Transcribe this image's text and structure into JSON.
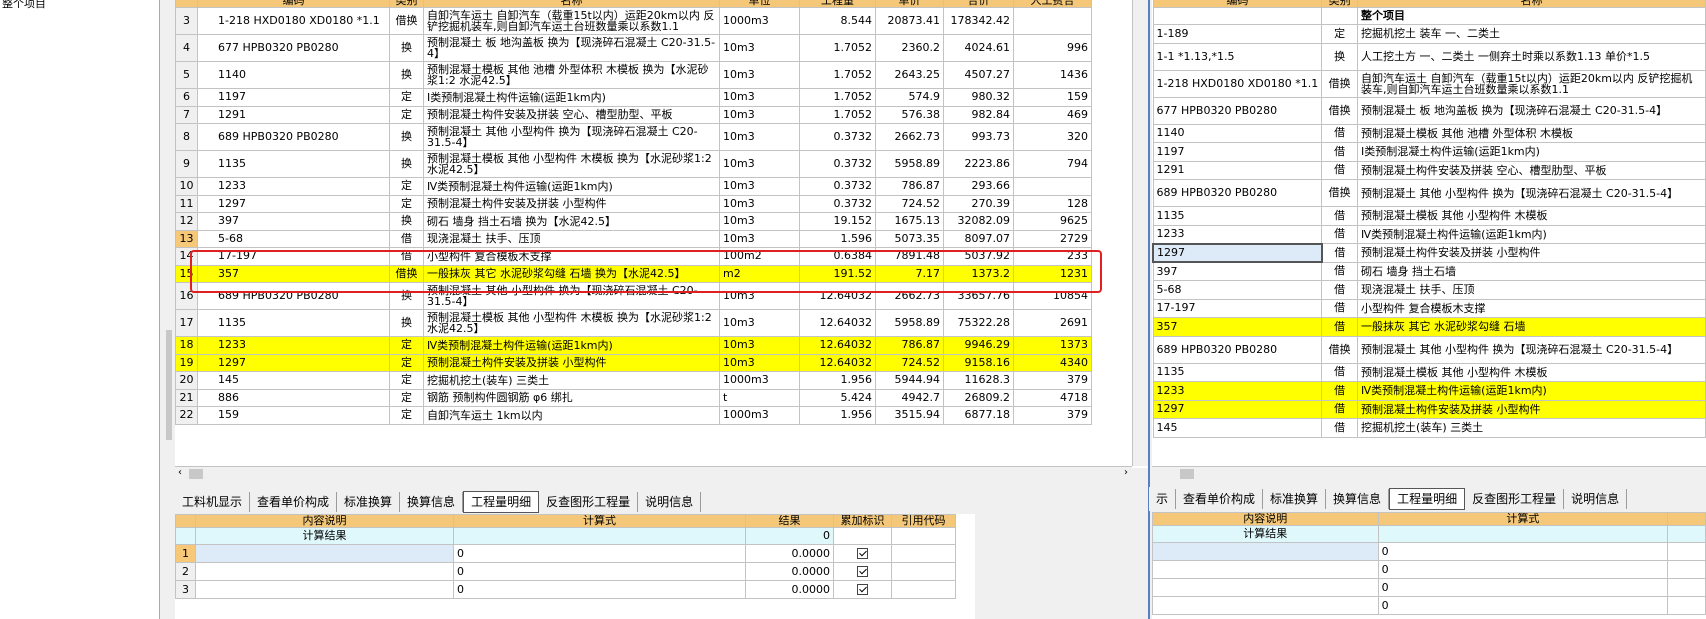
{
  "left_tree": {
    "root_label": "整个项目"
  },
  "main_grid": {
    "columns": [
      "编码",
      "类别",
      "名称",
      "单位",
      "工程量",
      "单价",
      "合价",
      "人工费合"
    ],
    "rows": [
      {
        "num": "3",
        "code": "1-218 HXD0180 XD0180 *1.1",
        "type": "借换",
        "name": "自卸汽车运土 自卸汽车（载重15t以内）运距20km以内 反铲挖掘机装车,则自卸汽车运土台班数量乘以系数1.1",
        "unit": "1000m3",
        "qty": "8.544",
        "price": "20873.41",
        "total": "178342.42",
        "labor": ""
      },
      {
        "num": "4",
        "code": "677 HPB0320 PB0280",
        "type": "换",
        "name": "预制混凝土 板 地沟盖板  换为【现浇碎石混凝土 C20-31.5-4】",
        "unit": "10m3",
        "qty": "1.7052",
        "price": "2360.2",
        "total": "4024.61",
        "labor": "996"
      },
      {
        "num": "5",
        "code": "1140",
        "type": "换",
        "name": "预制混凝土模板 其他 池槽 外型体积 木模板  换为【水泥砂浆1:2 水泥42.5】",
        "unit": "10m3",
        "qty": "1.7052",
        "price": "2643.25",
        "total": "4507.27",
        "labor": "1436"
      },
      {
        "num": "6",
        "code": "1197",
        "type": "定",
        "name": "Ⅰ类预制混凝土构件运输(运距1km内)",
        "unit": "10m3",
        "qty": "1.7052",
        "price": "574.9",
        "total": "980.32",
        "labor": "159"
      },
      {
        "num": "7",
        "code": "1291",
        "type": "定",
        "name": "预制混凝土构件安装及拼装 空心、槽型肋型、平板",
        "unit": "10m3",
        "qty": "1.7052",
        "price": "576.38",
        "total": "982.84",
        "labor": "469"
      },
      {
        "num": "8",
        "code": "689 HPB0320 PB0280",
        "type": "换",
        "name": "预制混凝土 其他 小型构件  换为【现浇碎石混凝土 C20-31.5-4】",
        "unit": "10m3",
        "qty": "0.3732",
        "price": "2662.73",
        "total": "993.73",
        "labor": "320"
      },
      {
        "num": "9",
        "code": "1135",
        "type": "换",
        "name": "预制混凝土模板 其他 小型构件 木模板  换为【水泥砂浆1:2 水泥42.5】",
        "unit": "10m3",
        "qty": "0.3732",
        "price": "5958.89",
        "total": "2223.86",
        "labor": "794"
      },
      {
        "num": "10",
        "code": "1233",
        "type": "定",
        "name": "Ⅳ类预制混凝土构件运输(运距1km内)",
        "unit": "10m3",
        "qty": "0.3732",
        "price": "786.87",
        "total": "293.66",
        "labor": ""
      },
      {
        "num": "11",
        "code": "1297",
        "type": "定",
        "name": "预制混凝土构件安装及拼装 小型构件",
        "unit": "10m3",
        "qty": "0.3732",
        "price": "724.52",
        "total": "270.39",
        "labor": "128"
      },
      {
        "num": "12",
        "code": "397",
        "type": "换",
        "name": "砌石 墙身 挡土石墙  换为【水泥42.5】",
        "unit": "10m3",
        "qty": "19.152",
        "price": "1675.13",
        "total": "32082.09",
        "labor": "9625"
      },
      {
        "num": "13",
        "code": "5-68",
        "type": "借",
        "name": "现浇混凝土 扶手、压顶",
        "unit": "10m3",
        "qty": "1.596",
        "price": "5073.35",
        "total": "8097.07",
        "labor": "2729"
      },
      {
        "num": "14",
        "code": "17-197",
        "type": "借",
        "name": "小型构件 复合模板木支撑",
        "unit": "100m2",
        "qty": "0.6384",
        "price": "7891.48",
        "total": "5037.92",
        "labor": "233"
      },
      {
        "num": "15",
        "code": "357",
        "type": "借换",
        "name": "一般抹灰 其它 水泥砂浆勾缝 石墙  换为【水泥42.5】",
        "unit": "m2",
        "qty": "191.52",
        "price": "7.17",
        "total": "1373.2",
        "labor": "1231"
      },
      {
        "num": "16",
        "code": "689 HPB0320 PB0280",
        "type": "换",
        "name": "预制混凝土 其他 小型构件  换为【现浇碎石混凝土 C20-31.5-4】",
        "unit": "10m3",
        "qty": "12.64032",
        "price": "2662.73",
        "total": "33657.76",
        "labor": "10854"
      },
      {
        "num": "17",
        "code": "1135",
        "type": "换",
        "name": "预制混凝土模板 其他 小型构件 木模板  换为【水泥砂浆1:2 水泥42.5】",
        "unit": "10m3",
        "qty": "12.64032",
        "price": "5958.89",
        "total": "75322.28",
        "labor": "2691"
      },
      {
        "num": "18",
        "code": "1233",
        "type": "定",
        "name": "Ⅳ类预制混凝土构件运输(运距1km内)",
        "unit": "10m3",
        "qty": "12.64032",
        "price": "786.87",
        "total": "9946.29",
        "labor": "1373"
      },
      {
        "num": "19",
        "code": "1297",
        "type": "定",
        "name": "预制混凝土构件安装及拼装 小型构件",
        "unit": "10m3",
        "qty": "12.64032",
        "price": "724.52",
        "total": "9158.16",
        "labor": "4340"
      },
      {
        "num": "20",
        "code": "145",
        "type": "定",
        "name": "挖掘机挖土(装车) 三类土",
        "unit": "1000m3",
        "qty": "1.956",
        "price": "5944.94",
        "total": "11628.3",
        "labor": "379"
      },
      {
        "num": "21",
        "code": "886",
        "type": "定",
        "name": "钢筋 预制构件圆钢筋 φ6 绑扎",
        "unit": "t",
        "qty": "5.424",
        "price": "4942.7",
        "total": "26809.2",
        "labor": "4718"
      },
      {
        "num": "22",
        "code": "159",
        "type": "定",
        "name": "自卸汽车运土 1km以内",
        "unit": "1000m3",
        "qty": "1.956",
        "price": "3515.94",
        "total": "6877.18",
        "labor": "379"
      }
    ]
  },
  "tabs_main": [
    "工料机显示",
    "查看单价构成",
    "标准换算",
    "换算信息",
    "工程量明细",
    "反查图形工程量",
    "说明信息"
  ],
  "tabs_right": [
    "示",
    "查看单价构成",
    "标准换算",
    "换算信息",
    "工程量明细",
    "反查图形工程量",
    "说明信息"
  ],
  "active_tab": "工程量明细",
  "calc_grid": {
    "columns": [
      "内容说明",
      "计算式",
      "结果",
      "累加标识",
      "引用代码"
    ],
    "result_label": "计算结果",
    "result_value": "0",
    "rows": [
      {
        "num": "1",
        "formula": "0",
        "result": "0.0000"
      },
      {
        "num": "2",
        "formula": "0",
        "result": "0.0000"
      },
      {
        "num": "3",
        "formula": "0",
        "result": "0.0000"
      }
    ]
  },
  "right_grid": {
    "columns": [
      "编码",
      "类别",
      "名称"
    ],
    "header_row": "整个项目",
    "rows": [
      {
        "code": "1-189",
        "type": "定",
        "name": "挖掘机挖土 装车 一、二类土"
      },
      {
        "code": "1-1 *1.13,*1.5",
        "type": "换",
        "name": "人工挖土方 一、二类土 一侧弃土时乘以系数1.13  单价*1.5"
      },
      {
        "code": "1-218 HXD0180 XD0180 *1.1",
        "type": "借换",
        "name": "自卸汽车运土 自卸汽车（载重15t以内）运距20km以内 反铲挖掘机装车,则自卸汽车运土台班数量乘以系数1.1"
      },
      {
        "code": "677 HPB0320 PB0280",
        "type": "借换",
        "name": "预制混凝土 板 地沟盖板  换为【现浇碎石混凝土 C20-31.5-4】"
      },
      {
        "code": "1140",
        "type": "借",
        "name": "预制混凝土模板 其他 池槽 外型体积 木模板"
      },
      {
        "code": "1197",
        "type": "借",
        "name": "Ⅰ类预制混凝土构件运输(运距1km内)"
      },
      {
        "code": "1291",
        "type": "借",
        "name": "预制混凝土构件安装及拼装 空心、槽型肋型、平板"
      },
      {
        "code": "689 HPB0320 PB0280",
        "type": "借换",
        "name": "预制混凝土 其他 小型构件  换为【现浇碎石混凝土 C20-31.5-4】"
      },
      {
        "code": "1135",
        "type": "借",
        "name": "预制混凝土模板 其他 小型构件 木模板"
      },
      {
        "code": "1233",
        "type": "借",
        "name": "Ⅳ类预制混凝土构件运输(运距1km内)"
      },
      {
        "code": "1297",
        "type": "借",
        "name": "预制混凝土构件安装及拼装 小型构件"
      },
      {
        "code": "397",
        "type": "借",
        "name": "砌石 墙身 挡土石墙"
      },
      {
        "code": "5-68",
        "type": "借",
        "name": "现浇混凝土 扶手、压顶"
      },
      {
        "code": "17-197",
        "type": "借",
        "name": "小型构件 复合模板木支撑"
      },
      {
        "code": "357",
        "type": "借",
        "name": "一般抹灰 其它 水泥砂浆勾缝 石墙"
      },
      {
        "code": "689 HPB0320 PB0280",
        "type": "借换",
        "name": "预制混凝土 其他 小型构件  换为【现浇碎石混凝土 C20-31.5-4】"
      },
      {
        "code": "1135",
        "type": "借",
        "name": "预制混凝土模板 其他 小型构件 木模板"
      },
      {
        "code": "1233",
        "type": "借",
        "name": "Ⅳ类预制混凝土构件运输(运距1km内)"
      },
      {
        "code": "1297",
        "type": "借",
        "name": "预制混凝土构件安装及拼装 小型构件"
      },
      {
        "code": "145",
        "type": "借",
        "name": "挖掘机挖土(装车) 三类土"
      }
    ]
  },
  "right_calc": {
    "columns": [
      "内容说明",
      "计算式"
    ],
    "result_label": "计算结果",
    "rows": [
      {
        "formula": "0"
      },
      {
        "formula": "0"
      },
      {
        "formula": "0"
      },
      {
        "formula": "0"
      }
    ]
  },
  "colors": {
    "header": "#f4c878",
    "highlight": "#ffff00",
    "result_row": "#dff8fb",
    "red_box": "#e02020"
  }
}
